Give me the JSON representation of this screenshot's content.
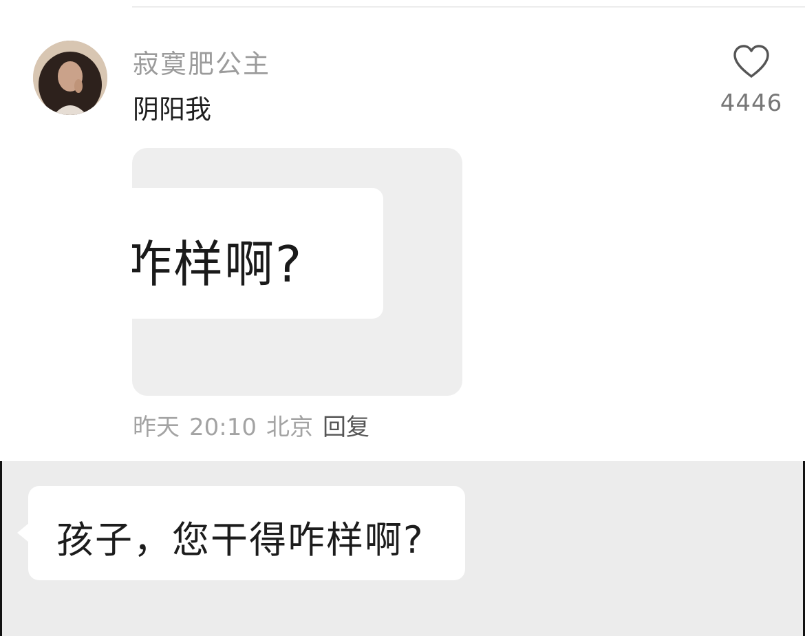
{
  "comment": {
    "username": "寂寞肥公主",
    "text": "阴阳我",
    "like_count": "4446",
    "image_text": "咋样啊?",
    "meta": {
      "date": "昨天",
      "time": "20:10",
      "location": "北京",
      "reply_label": "回复"
    }
  },
  "quoted_message": {
    "text": "孩子，您干得咋样啊?"
  },
  "icons": {
    "like": "heart-outline-icon",
    "avatar": "user-avatar-photo"
  },
  "colors": {
    "username": "#9b9b9b",
    "meta": "#a3a3a3",
    "reply": "#555555",
    "card_bg": "#eeeeee",
    "panel_bg": "#ececec"
  }
}
